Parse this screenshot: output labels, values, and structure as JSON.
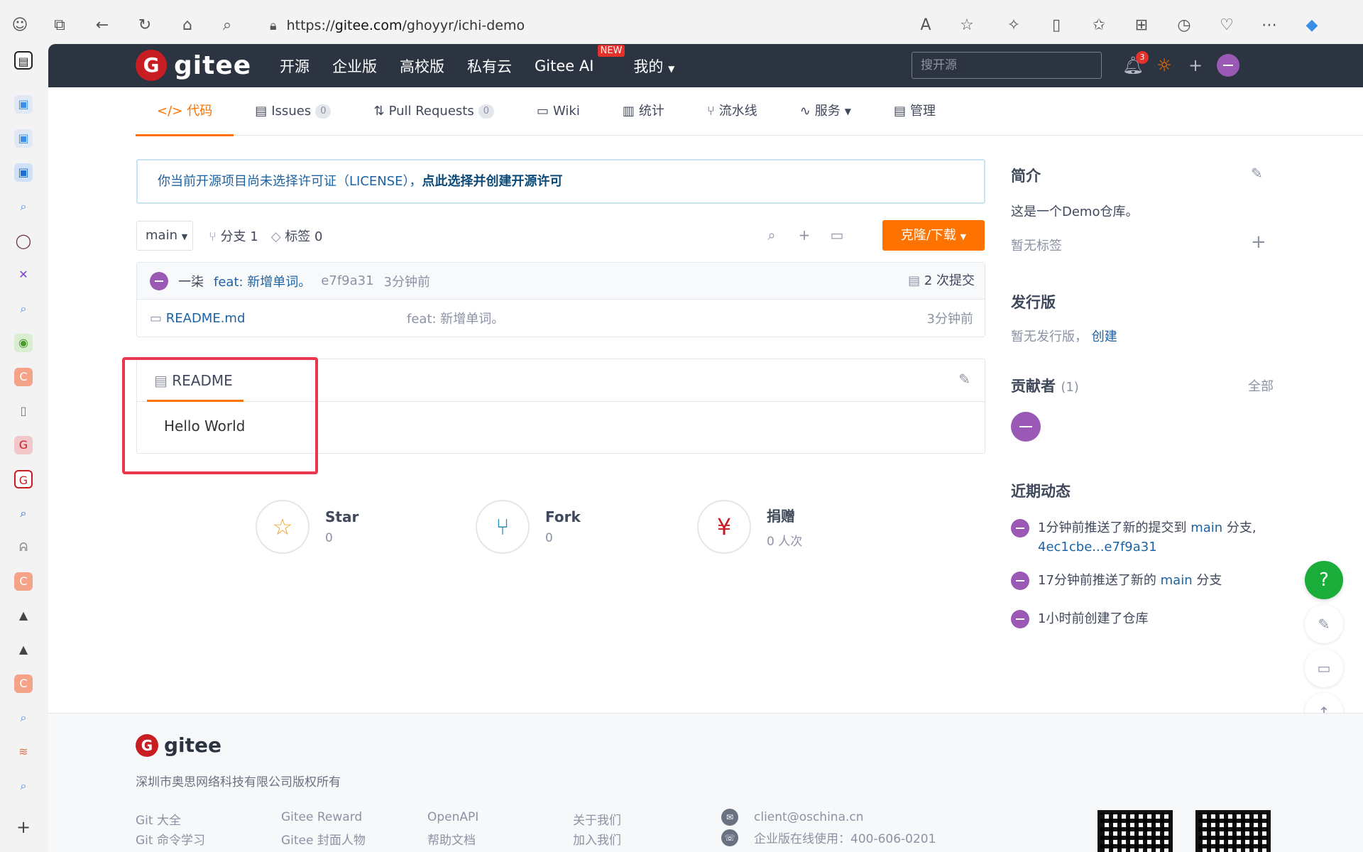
{
  "browser": {
    "url_prefix": "https://",
    "url_domain": "gitee.com",
    "url_path": "/ghoyyr/ichi-demo"
  },
  "nav": {
    "logo_text": "gitee",
    "items": [
      "开源",
      "企业版",
      "高校版",
      "私有云",
      "Gitee AI",
      "我的"
    ],
    "new_badge": "NEW",
    "search_placeholder": "搜开源",
    "notification_count": "3"
  },
  "tabs": [
    {
      "label": "代码",
      "icon": "code-icon"
    },
    {
      "label": "Issues",
      "count": "0",
      "icon": "issues-icon"
    },
    {
      "label": "Pull Requests",
      "count": "0",
      "icon": "pull-request-icon"
    },
    {
      "label": "Wiki",
      "icon": "wiki-icon"
    },
    {
      "label": "统计",
      "icon": "stats-icon"
    },
    {
      "label": "流水线",
      "icon": "pipeline-icon"
    },
    {
      "label": "服务",
      "icon": "service-icon"
    },
    {
      "label": "管理",
      "icon": "manage-icon"
    }
  ],
  "notice": {
    "text": "你当前开源项目尚未选择许可证（LICENSE），",
    "link": "点此选择并创建开源许可"
  },
  "branch": {
    "current": "main",
    "branches": "分支 1",
    "tags": "标签 0",
    "clone_label": "克隆/下载"
  },
  "commit": {
    "author": "一柒",
    "message": "feat: 新增单词。",
    "hash": "e7f9a31",
    "time": "3分钟前",
    "count": "2 次提交"
  },
  "files": [
    {
      "name": "README.md",
      "message": "feat: 新增单词。",
      "time": "3分钟前"
    }
  ],
  "readme": {
    "tab": "README",
    "content": "Hello World"
  },
  "stats": [
    {
      "label": "Star",
      "value": "0",
      "icon": "star-icon"
    },
    {
      "label": "Fork",
      "value": "0",
      "icon": "fork-icon"
    },
    {
      "label": "捐赠",
      "value": "0 人次",
      "icon": "donate-icon"
    }
  ],
  "sidebar": {
    "intro_title": "简介",
    "intro_text": "这是一个Demo仓库。",
    "no_tags": "暂无标签",
    "release_title": "发行版",
    "no_release": "暂无发行版，",
    "create_link": "创建",
    "contributors_title": "贡献者",
    "contributors_count": "(1)",
    "all_link": "全部",
    "activity_title": "近期动态",
    "activities": [
      {
        "pre": "1分钟前推送了新的提交到 ",
        "link": "main",
        "post": " 分支,",
        "line2": "4ec1cbe...e7f9a31"
      },
      {
        "pre": "17分钟前推送了新的 ",
        "link": "main",
        "post": " 分支",
        "line2": ""
      },
      {
        "pre": "1小时前创建了仓库",
        "link": "",
        "post": "",
        "line2": ""
      }
    ]
  },
  "footer": {
    "logo_text": "gitee",
    "copyright": "深圳市奥思网络科技有限公司版权所有",
    "links_col1": [
      "Git 大全",
      "Git 命令学习"
    ],
    "links_col2": [
      "Gitee Reward",
      "Gitee 封面人物"
    ],
    "links_col3": [
      "OpenAPI",
      "帮助文档"
    ],
    "links_col4": [
      "关于我们",
      "加入我们"
    ],
    "email": "client@oschina.cn",
    "phone": "企业版在线使用：400-606-0201"
  },
  "colors": {
    "accent": "#fe7300",
    "nav_bg": "#2c3341",
    "link": "#1d62a3",
    "highlight": "#e8384f"
  }
}
